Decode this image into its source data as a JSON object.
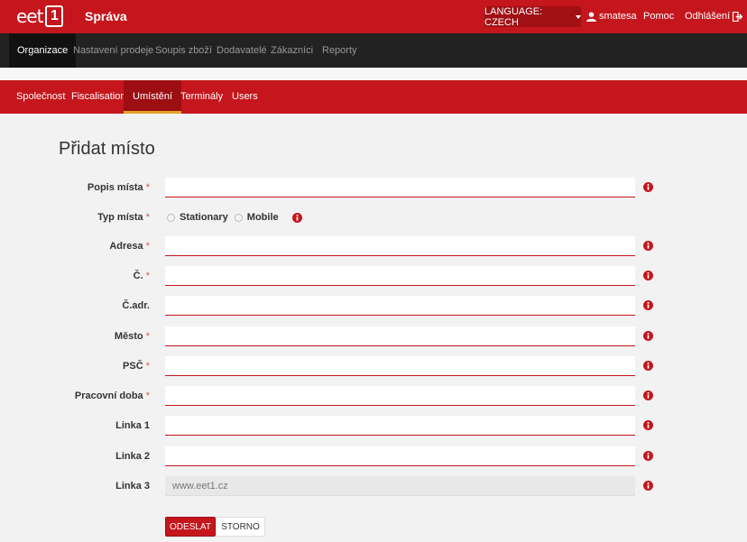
{
  "brand": {
    "logo_text": "eet",
    "logo_number": "1",
    "app_title": "Správa"
  },
  "topbar": {
    "language_label": "LANGUAGE: CZECH",
    "username": "smatesa",
    "help": "Pomoc",
    "logout": "Odhlášení"
  },
  "main_nav": [
    "Organizace",
    "Nastavení prodeje",
    "Soupis zboží",
    "Dodavatelé",
    "Zákazníci",
    "Reporty"
  ],
  "sub_nav": [
    "Společnost",
    "Fiscalisation",
    "Umístění",
    "Terminály",
    "Users"
  ],
  "page": {
    "title": "Přidat místo"
  },
  "form": {
    "popis": {
      "label": "Popis místa",
      "value": ""
    },
    "typ": {
      "label": "Typ místa",
      "options": [
        "Stationary",
        "Mobile"
      ]
    },
    "adresa": {
      "label": "Adresa",
      "value": ""
    },
    "cislo": {
      "label": "Č.",
      "value": ""
    },
    "cadr": {
      "label": "Č.adr.",
      "value": ""
    },
    "mesto": {
      "label": "Město",
      "value": ""
    },
    "psc": {
      "label": "PSČ",
      "value": ""
    },
    "doba": {
      "label": "Pracovní doba",
      "value": ""
    },
    "linka1": {
      "label": "Linka 1",
      "value": ""
    },
    "linka2": {
      "label": "Linka 2",
      "value": ""
    },
    "linka3": {
      "label": "Linka 3",
      "value": "www.eet1.cz"
    },
    "required_mark": "*"
  },
  "buttons": {
    "submit": "ODESLAT",
    "cancel": "STORNO"
  },
  "colors": {
    "brand_red": "#c4161c",
    "dark_nav": "#222222",
    "active_underline": "#e3a228"
  },
  "icons": {
    "info": "info-circle-icon",
    "user": "user-icon",
    "logout": "logout-icon",
    "caret": "chevron-down-icon"
  }
}
